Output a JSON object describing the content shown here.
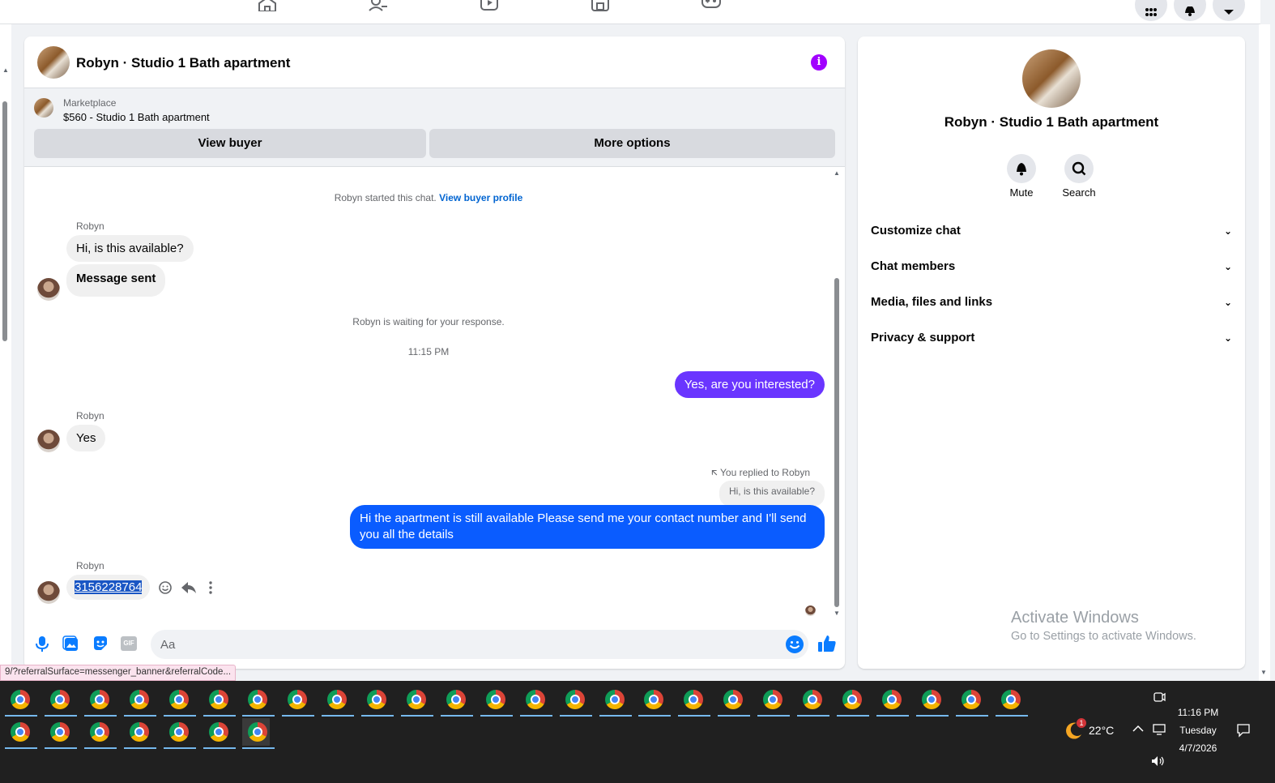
{
  "chat": {
    "title": "Robyn · Studio 1 Bath apartment",
    "marketplace_label": "Marketplace",
    "listing": "$560 - Studio 1 Bath apartment",
    "view_buyer": "View buyer",
    "more_options": "More options",
    "started_text": "Robyn started this chat.",
    "view_buyer_profile": "View buyer profile",
    "waiting_text": "Robyn is waiting for your response.",
    "time_divider": "11:15 PM",
    "messages": [
      {
        "sender": "Robyn",
        "text": "Hi, is this available?"
      },
      {
        "text": "Message sent"
      },
      {
        "text": "Yes, are you interested?"
      },
      {
        "sender": "Robyn",
        "text": "Yes"
      },
      {
        "reply_label": "You replied to Robyn",
        "quoted": "Hi, is this available?"
      },
      {
        "text": "Hi the apartment is still available Please send me your contact number and I'll send you all the details"
      },
      {
        "sender": "Robyn",
        "text": "3156228764"
      }
    ],
    "composer_placeholder": "Aa",
    "gif_label": "GIF",
    "info_glyph": "i"
  },
  "status_url": "9/?referralSurface=messenger_banner&referralCode...",
  "right_panel": {
    "title": "Robyn · Studio 1 Bath apartment",
    "mute": "Mute",
    "search": "Search",
    "sections": [
      "Customize chat",
      "Chat members",
      "Media, files and links",
      "Privacy & support"
    ],
    "watermark_title": "Activate Windows",
    "watermark_sub": "Go to Settings to activate Windows."
  },
  "taskbar": {
    "temperature": "22°C",
    "weather_badge": "1",
    "time": "11:16 PM",
    "day": "Tuesday",
    "date": "4/7/2026"
  },
  "colors": {
    "accent_purple": "#6a35ff",
    "accent_blue": "#0a5cff",
    "info_purple": "#a100ff"
  }
}
